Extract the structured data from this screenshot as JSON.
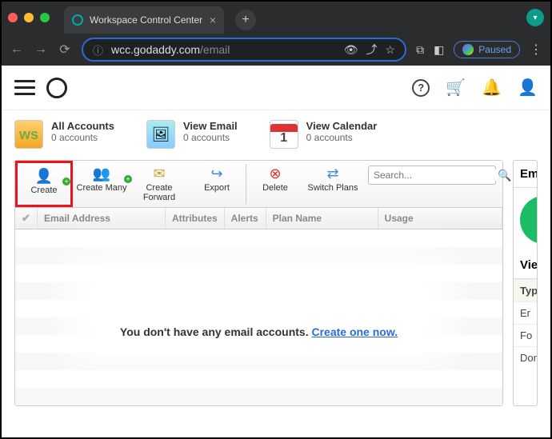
{
  "browser": {
    "tab_title": "Workspace Control Center",
    "url_host": "wcc.godaddy.com",
    "url_path": "/email",
    "paused_label": "Paused"
  },
  "summaries": [
    {
      "title": "All Accounts",
      "sub": "0 accounts"
    },
    {
      "title": "View Email",
      "sub": "0 accounts"
    },
    {
      "title": "View Calendar",
      "sub": "0 accounts"
    }
  ],
  "actions": {
    "create": "Create",
    "create_many": "Create Many",
    "create_forward": "Create Forward",
    "export": "Export",
    "delete": "Delete",
    "switch_plans": "Switch Plans"
  },
  "search_placeholder": "Search...",
  "columns": {
    "email": "Email Address",
    "attr": "Attributes",
    "alerts": "Alerts",
    "plan": "Plan Name",
    "usage": "Usage"
  },
  "empty": {
    "msg": "You don't have any email accounts.",
    "link": "Create one now."
  },
  "right": {
    "heading": "Em",
    "view": "Vie",
    "type": "Type",
    "rows": [
      "Er",
      "Fo",
      "Dom"
    ]
  },
  "calendar_icon_day": "1"
}
